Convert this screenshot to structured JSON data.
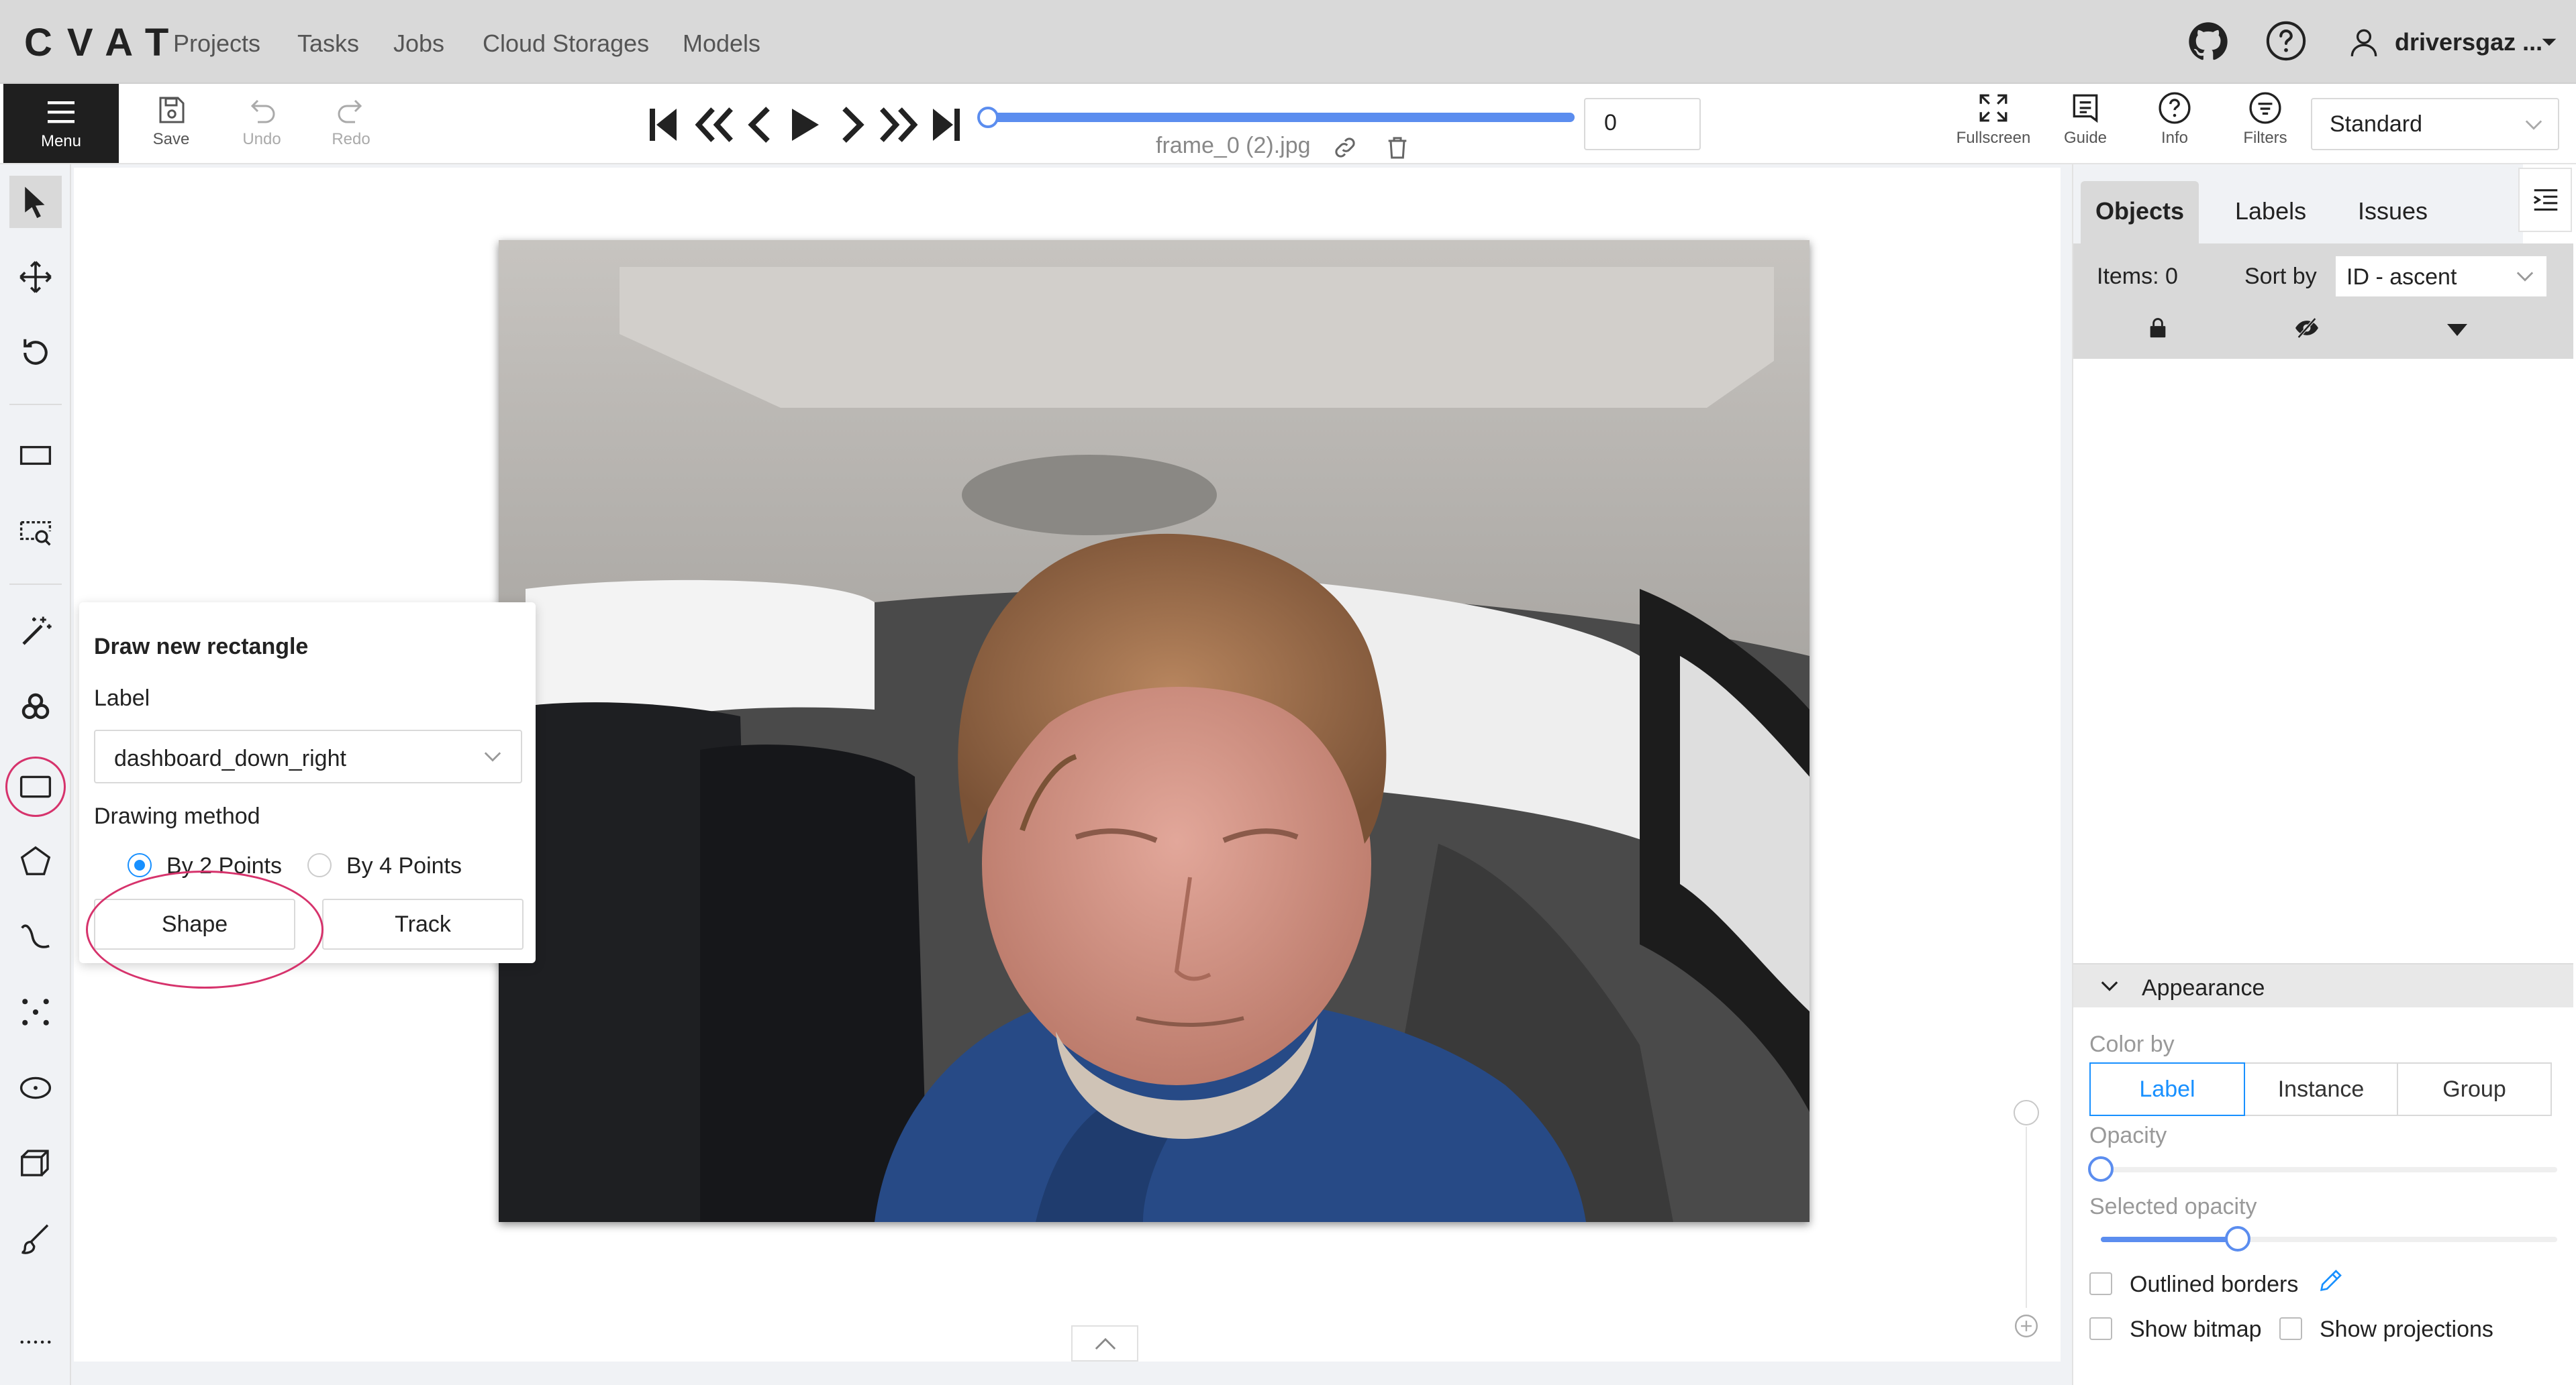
{
  "app": {
    "logo": "CVAT"
  },
  "nav": {
    "items": [
      "Projects",
      "Tasks",
      "Jobs",
      "Cloud Storages",
      "Models"
    ]
  },
  "user": {
    "name": "driversgaz ..."
  },
  "toolbar": {
    "menu_label": "Menu",
    "save_label": "Save",
    "undo_label": "Undo",
    "redo_label": "Redo",
    "frame_filename": "frame_0 (2).jpg",
    "frame_number": "0",
    "fullscreen_label": "Fullscreen",
    "guide_label": "Guide",
    "info_label": "Info",
    "filters_label": "Filters",
    "workspace_value": "Standard"
  },
  "player": {
    "progress": 1.0
  },
  "popover": {
    "title": "Draw new rectangle",
    "label_heading": "Label",
    "label_value": "dashboard_down_right",
    "method_heading": "Drawing method",
    "option_2points": "By 2 Points",
    "option_4points": "By 4 Points",
    "selected_option": "By 2 Points",
    "shape_button": "Shape",
    "track_button": "Track"
  },
  "right_panel": {
    "tabs": [
      "Objects",
      "Labels",
      "Issues"
    ],
    "active_tab": "Objects",
    "items_count": "Items: 0",
    "sort_label": "Sort by",
    "sort_value": "ID - ascent",
    "appearance_title": "Appearance",
    "color_by_label": "Color by",
    "color_by_options": [
      "Label",
      "Instance",
      "Group"
    ],
    "color_by_selected": "Label",
    "opacity_label": "Opacity",
    "opacity_value": 0.0,
    "selected_opacity_label": "Selected opacity",
    "selected_opacity_value": 0.3,
    "outlined_borders_label": "Outlined borders",
    "show_bitmap_label": "Show bitmap",
    "show_projections_label": "Show projections"
  },
  "colors": {
    "accent": "#1890ff",
    "annotation_highlight": "#d6336c",
    "topbar": "#d9d9d9",
    "menu_bg": "#1f1f1f"
  }
}
